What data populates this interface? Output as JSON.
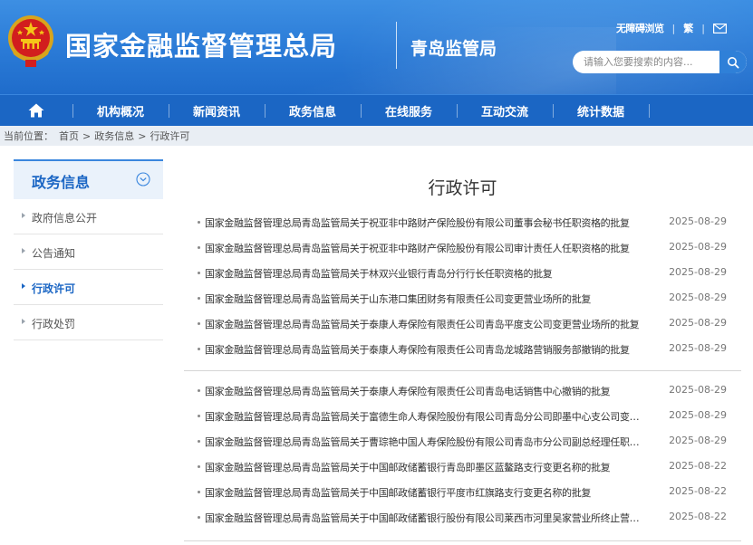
{
  "header": {
    "site_title": "国家金融监督管理总局",
    "branch_title": "青岛监管局",
    "accessibility_link": "无障碍浏览",
    "traditional_link": "繁",
    "search_placeholder": "请输入您要搜索的内容...",
    "colors": {
      "header_blue": "#2a7ad6",
      "nav_blue": "#1b66c4"
    }
  },
  "nav": {
    "home_icon": "home-icon",
    "items": [
      {
        "label": "机构概况"
      },
      {
        "label": "新闻资讯"
      },
      {
        "label": "政务信息"
      },
      {
        "label": "在线服务"
      },
      {
        "label": "互动交流"
      },
      {
        "label": "统计数据"
      }
    ]
  },
  "breadcrumb": {
    "prefix": "当前位置：",
    "items": [
      "首页",
      "政务信息",
      "行政许可"
    ],
    "separator": ">"
  },
  "sidebar": {
    "title": "政务信息",
    "items": [
      {
        "label": "政府信息公开",
        "active": false
      },
      {
        "label": "公告通知",
        "active": false
      },
      {
        "label": "行政许可",
        "active": true
      },
      {
        "label": "行政处罚",
        "active": false
      }
    ]
  },
  "main": {
    "title": "行政许可",
    "groups": [
      [
        {
          "title": "国家金融监督管理总局青岛监管局关于祝亚非中路财产保险股份有限公司董事会秘书任职资格的批复",
          "date": "2025-08-29"
        },
        {
          "title": "国家金融监督管理总局青岛监管局关于祝亚非中路财产保险股份有限公司审计责任人任职资格的批复",
          "date": "2025-08-29"
        },
        {
          "title": "国家金融监督管理总局青岛监管局关于林双兴业银行青岛分行行长任职资格的批复",
          "date": "2025-08-29"
        },
        {
          "title": "国家金融监督管理总局青岛监管局关于山东港口集团财务有限责任公司变更营业场所的批复",
          "date": "2025-08-29"
        },
        {
          "title": "国家金融监督管理总局青岛监管局关于泰康人寿保险有限责任公司青岛平度支公司变更营业场所的批复",
          "date": "2025-08-29"
        },
        {
          "title": "国家金融监督管理总局青岛监管局关于泰康人寿保险有限责任公司青岛龙城路营销服务部撤销的批复",
          "date": "2025-08-29"
        }
      ],
      [
        {
          "title": "国家金融监督管理总局青岛监管局关于泰康人寿保险有限责任公司青岛电话销售中心撤销的批复",
          "date": "2025-08-29"
        },
        {
          "title": "国家金融监督管理总局青岛监管局关于富德生命人寿保险股份有限公司青岛分公司即墨中心支公司变更...",
          "date": "2025-08-29"
        },
        {
          "title": "国家金融监督管理总局青岛监管局关于曹琮艳中国人寿保险股份有限公司青岛市分公司副总经理任职资...",
          "date": "2025-08-29"
        },
        {
          "title": "国家金融监督管理总局青岛监管局关于中国邮政储蓄银行青岛即墨区蓝鳌路支行变更名称的批复",
          "date": "2025-08-22"
        },
        {
          "title": "国家金融监督管理总局青岛监管局关于中国邮政储蓄银行平度市红旗路支行变更名称的批复",
          "date": "2025-08-22"
        },
        {
          "title": "国家金融监督管理总局青岛监管局关于中国邮政储蓄银行股份有限公司莱西市河里吴家营业所终止营业...",
          "date": "2025-08-22"
        }
      ]
    ]
  }
}
